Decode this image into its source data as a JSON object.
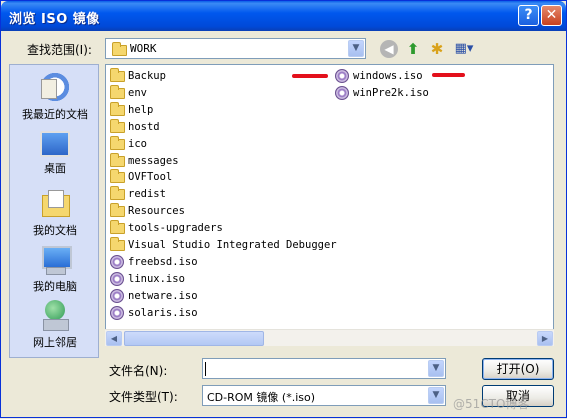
{
  "window": {
    "title": "浏览 ISO 镜像"
  },
  "titlebar_buttons": {
    "help": "?",
    "close": "✕"
  },
  "toolbar": {
    "look_in_label": "查找范围(I):",
    "look_in_value": "WORK",
    "icons": [
      "back-icon",
      "up-folder-icon",
      "new-folder-icon",
      "views-menu-icon"
    ]
  },
  "places": [
    {
      "label": "我最近的文档",
      "icon": "recent-documents-icon"
    },
    {
      "label": "桌面",
      "icon": "desktop-icon"
    },
    {
      "label": "我的文档",
      "icon": "my-documents-icon"
    },
    {
      "label": "我的电脑",
      "icon": "my-computer-icon"
    },
    {
      "label": "网上邻居",
      "icon": "network-places-icon"
    }
  ],
  "files": {
    "column1": [
      {
        "name": "Backup",
        "type": "folder"
      },
      {
        "name": "env",
        "type": "folder"
      },
      {
        "name": "help",
        "type": "folder"
      },
      {
        "name": "hostd",
        "type": "folder"
      },
      {
        "name": "ico",
        "type": "folder"
      },
      {
        "name": "messages",
        "type": "folder"
      },
      {
        "name": "OVFTool",
        "type": "folder"
      },
      {
        "name": "redist",
        "type": "folder"
      },
      {
        "name": "Resources",
        "type": "folder"
      },
      {
        "name": "tools-upgraders",
        "type": "folder"
      },
      {
        "name": "Visual Studio Integrated Debugger",
        "type": "folder"
      },
      {
        "name": "freebsd.iso",
        "type": "iso"
      },
      {
        "name": "linux.iso",
        "type": "iso"
      },
      {
        "name": "netware.iso",
        "type": "iso"
      },
      {
        "name": "solaris.iso",
        "type": "iso"
      }
    ],
    "column2": [
      {
        "name": "windows.iso",
        "type": "iso"
      },
      {
        "name": "winPre2k.iso",
        "type": "iso"
      }
    ]
  },
  "footer": {
    "filename_label": "文件名(N):",
    "filename_value": "",
    "filetype_label": "文件类型(T):",
    "filetype_value": "CD-ROM 镜像 (*.iso)",
    "open_button": "打开(O)",
    "cancel_button": "取消"
  },
  "watermark": "@51CTO博客",
  "colors": {
    "titlebar": "#0058EE",
    "annotation_red": "#E3101B",
    "places_bg": "#D6DFF7"
  }
}
